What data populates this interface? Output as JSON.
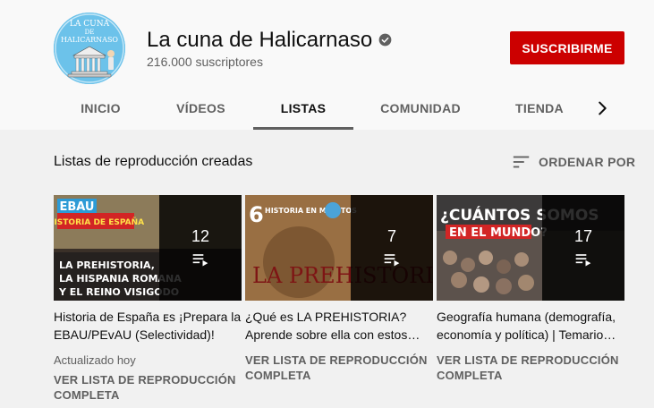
{
  "channel": {
    "name": "La cuna de Halicarnaso",
    "subscribers": "216.000 suscriptores",
    "subscribe_label": "SUSCRIBIRME",
    "avatar_text_top": "LA CUNA",
    "avatar_text_mid": "DE",
    "avatar_text_bottom": "HALICARNASO"
  },
  "tabs": [
    {
      "label": "INICIO",
      "active": false
    },
    {
      "label": "VÍDEOS",
      "active": false
    },
    {
      "label": "LISTAS",
      "active": true
    },
    {
      "label": "COMUNIDAD",
      "active": false
    },
    {
      "label": "TIENDA",
      "active": false
    }
  ],
  "section": {
    "title": "Listas de reproducción creadas",
    "sort_label": "ORDENAR POR"
  },
  "playlists": [
    {
      "count": "12",
      "title": "Historia de España ᴇs ¡Prepara la EBAU/PEvAU (Selectividad)!",
      "meta": "Actualizado hoy",
      "link": "VER LISTA DE REPRODUCCIÓN COMPLETA",
      "thumb_badge": "EBAU",
      "thumb_subtitle": "HISTORIA DE ESPAÑA",
      "thumb_line1": "LA PREHISTORIA,",
      "thumb_line2": "LA HISPANIA ROMANA",
      "thumb_line3": "Y EL REINO VISIGODO"
    },
    {
      "count": "7",
      "title": "¿Qué es LA PREHISTORIA? Aprende sobre ella con estos…",
      "link": "VER LISTA DE REPRODUCCIÓN COMPLETA",
      "thumb_badge": "6",
      "thumb_subtitle": "HISTORIA EN MINUTOS",
      "thumb_line1": "LA PREHISTORIA"
    },
    {
      "count": "17",
      "title": "Geografía humana (demografía, economía y política) | Temario…",
      "link": "VER LISTA DE REPRODUCCIÓN COMPLETA",
      "thumb_line1": "¿CUÁNTOS SOMOS",
      "thumb_line2": "EN EL MUNDO?"
    }
  ],
  "colors": {
    "subscribe": "#cc0000",
    "background": "#f1f1f1",
    "header": "#f9f9f9",
    "avatar": "#6cc2ea"
  }
}
